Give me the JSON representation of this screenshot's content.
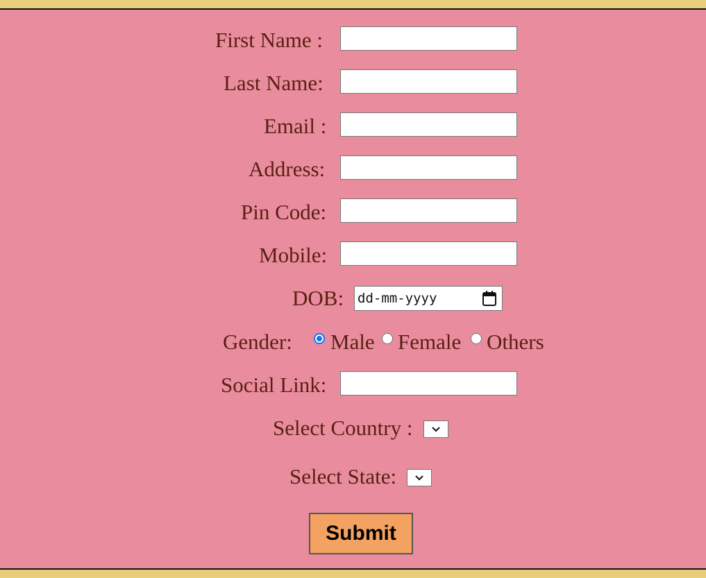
{
  "form": {
    "first_name": {
      "label": "First Name :",
      "value": ""
    },
    "last_name": {
      "label": "Last Name:",
      "value": ""
    },
    "email": {
      "label": "Email :",
      "value": ""
    },
    "address": {
      "label": "Address:",
      "value": ""
    },
    "pin_code": {
      "label": "Pin Code:",
      "value": ""
    },
    "mobile": {
      "label": "Mobile:",
      "value": ""
    },
    "dob": {
      "label": "DOB:",
      "placeholder": "dd-mm-yyyy"
    },
    "gender": {
      "label": "Gender:",
      "options": [
        "Male",
        "Female",
        "Others"
      ],
      "selected": "Male"
    },
    "social_link": {
      "label": "Social Link:",
      "value": ""
    },
    "country": {
      "label": "Select Country :",
      "selected": ""
    },
    "state": {
      "label": "Select State:",
      "selected": ""
    },
    "submit_label": "Submit"
  },
  "icons": {
    "date_picker": "calendar-icon",
    "dropdown": "chevron-down-icon"
  },
  "colors": {
    "page_border": "#e8cd7a",
    "form_background": "#e98d9e",
    "label_text": "#5a1f12",
    "submit_background": "#f4a261",
    "radio_selected": "#1a73e8"
  }
}
